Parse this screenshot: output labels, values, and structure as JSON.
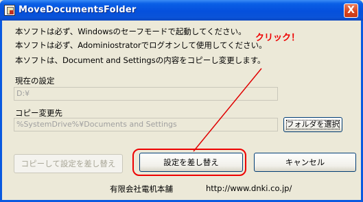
{
  "window": {
    "title": "MoveDocumentsFolder",
    "close_glyph": "X"
  },
  "info_lines": [
    "本ソフトは必ず、Windowsのセーフモードで起動してください。",
    "本ソフトは必ず、Adominiostratorでログオンして使用してください。",
    "本ソフトは、Document and Settingsの内容をコピーし変更します。"
  ],
  "current_setting": {
    "label": "現在の設定",
    "value": "D:¥"
  },
  "copy_destination": {
    "label": "コピー変更先",
    "value": "%SystemDrive%¥Documents and Settings",
    "browse_label": "フォルダを選択"
  },
  "buttons": {
    "copy_replace": "コピーして設定を差し替え",
    "replace": "設定を差し替え",
    "cancel": "キャンセル"
  },
  "annotation": {
    "label": "クリック！",
    "color": "#e00000"
  },
  "footer": {
    "company": "有限会社電机本舗",
    "url": "http://www.dnki.co.jp/"
  }
}
